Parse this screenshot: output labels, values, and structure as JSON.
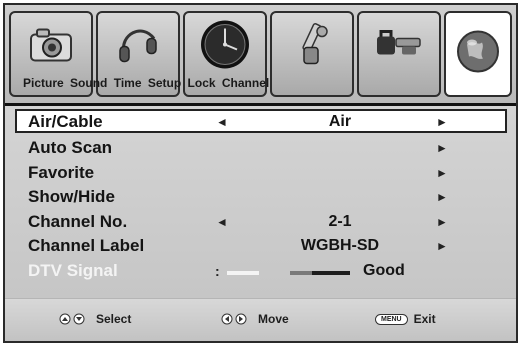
{
  "tabs": [
    {
      "label": "Picture",
      "icon": "camera-icon",
      "selected": false
    },
    {
      "label": "Sound",
      "icon": "headphones-icon",
      "selected": false
    },
    {
      "label": "Time",
      "icon": "clock-icon",
      "selected": false
    },
    {
      "label": "Setup",
      "icon": "tools-icon",
      "selected": false
    },
    {
      "label": "Lock",
      "icon": "lock-icon",
      "selected": false
    },
    {
      "label": "Channel",
      "icon": "globe-icon",
      "selected": true
    }
  ],
  "menu": {
    "air_cable": {
      "label": "Air/Cable",
      "value": "Air"
    },
    "auto_scan": {
      "label": "Auto Scan"
    },
    "favorite": {
      "label": "Favorite"
    },
    "show_hide": {
      "label": "Show/Hide"
    },
    "channel_no": {
      "label": "Channel No.",
      "value": "2-1"
    },
    "channel_label": {
      "label": "Channel Label",
      "value": "WGBH-SD"
    },
    "dtv_signal": {
      "label": "DTV Signal",
      "separator": ":",
      "quality": "Good"
    }
  },
  "glyphs": {
    "left_arrow": "◄",
    "right_arrow": "►"
  },
  "footer": {
    "select_label": "Select",
    "move_label": "Move",
    "menu_button_text": "MENU",
    "exit_label": "Exit"
  }
}
